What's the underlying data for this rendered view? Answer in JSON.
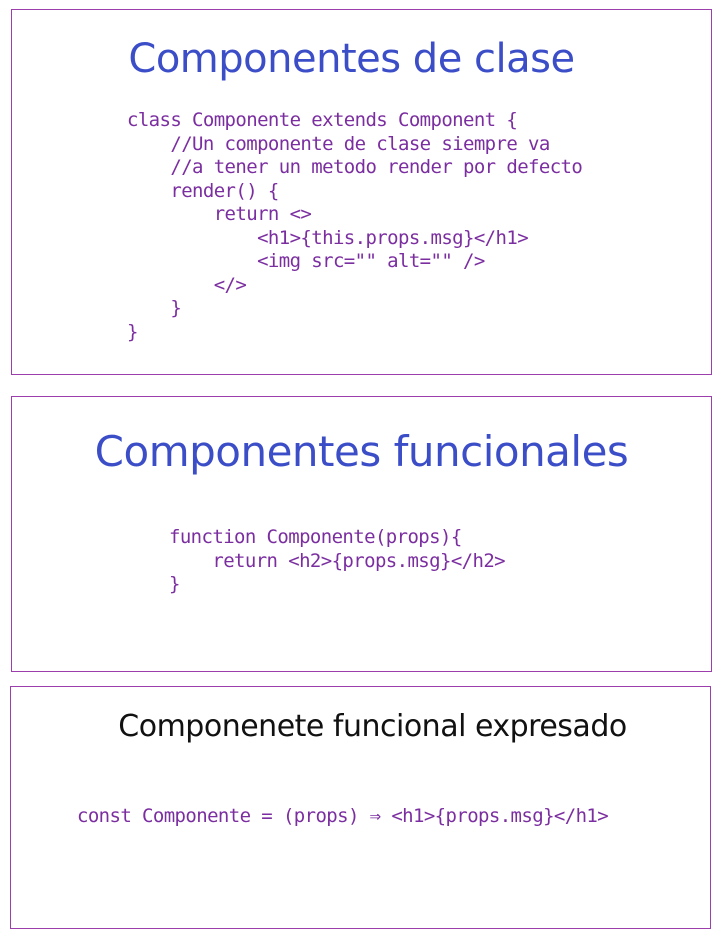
{
  "sections": [
    {
      "title": "Componentes de clase",
      "code": "class Componente extends Component {\n    //Un componente de clase siempre va\n    //a tener un metodo render por defecto\n    render() {\n        return <>\n            <h1>{this.props.msg}</h1>\n            <img src=\"\" alt=\"\" />\n        </>\n    }\n}"
    },
    {
      "title": "Componentes funcionales",
      "code": "function Componente(props){\n    return <h2>{props.msg}</h2>\n}"
    },
    {
      "title": "Componenete funcional expresado",
      "code": "const Componente = (props) ⇒ <h1>{props.msg}</h1>"
    }
  ],
  "colors": {
    "border": "#9c3fad",
    "title_blue": "#3b4ec8",
    "title_black": "#111111",
    "code": "#7b2ea0"
  }
}
